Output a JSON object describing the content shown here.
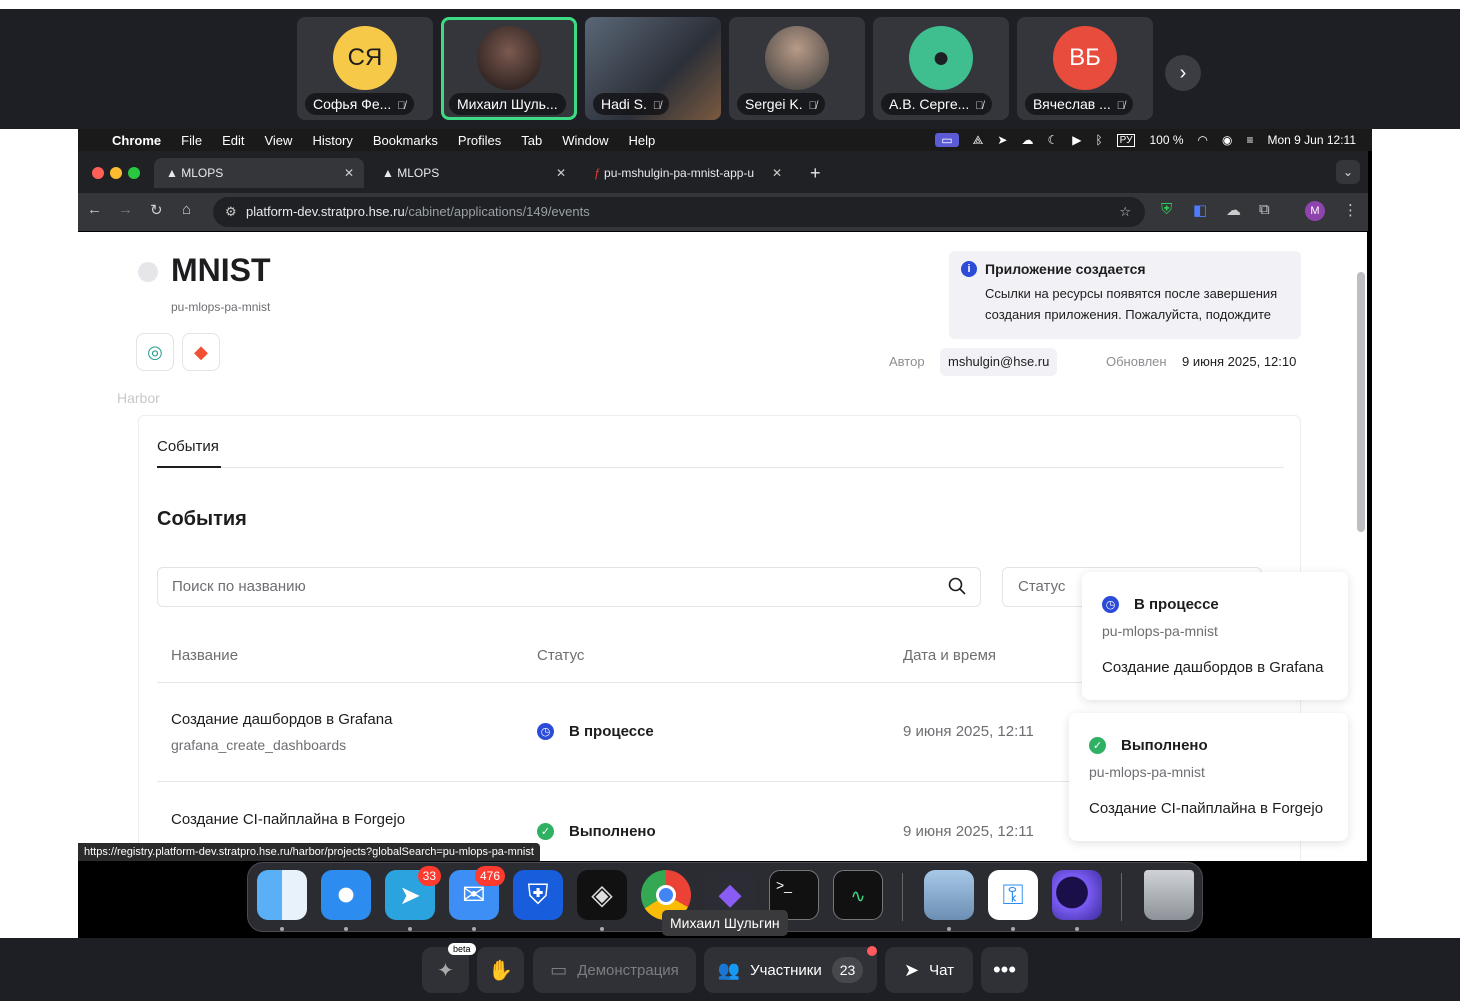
{
  "call": {
    "participants": [
      {
        "initials": "СЯ",
        "name": "Софья Фе...",
        "color": "#f7c948",
        "muted": true,
        "video": false
      },
      {
        "initials": "",
        "name": "Михаил Шуль...",
        "color": "#3a2a2a",
        "muted": false,
        "video": true,
        "active": true
      },
      {
        "initials": "",
        "name": "Hadi S.",
        "color": "#555",
        "muted": true,
        "video": true
      },
      {
        "initials": "",
        "name": "Sergei K.",
        "color": "#555",
        "muted": true,
        "video": true
      },
      {
        "initials": "",
        "name": "А.В. Серге...",
        "color": "#3fbf8f",
        "muted": true,
        "video": false
      },
      {
        "initials": "ВБ",
        "name": "Вячеслав ...",
        "color": "#e74c3c",
        "muted": true,
        "video": false
      }
    ],
    "toolbar": {
      "beta": "beta",
      "demo": "Демонстрация",
      "participants": "Участники",
      "participants_count": "23",
      "chat": "Чат"
    }
  },
  "macos": {
    "menu": [
      "Chrome",
      "File",
      "Edit",
      "View",
      "History",
      "Bookmarks",
      "Profiles",
      "Tab",
      "Window",
      "Help"
    ],
    "keyboard": "РУ",
    "battery": "100 %",
    "clock": "Mon 9 Jun  12:11"
  },
  "browser": {
    "tabs": [
      {
        "title": "MLOPS",
        "active": true
      },
      {
        "title": "MLOPS",
        "active": false
      },
      {
        "title": "pu-mshulgin-pa-mnist-app-u",
        "active": false
      }
    ],
    "url_host": "platform-dev.stratpro.hse.ru",
    "url_path": "/cabinet/applications/149/events",
    "status_url": "https://registry.platform-dev.stratpro.hse.ru/harbor/projects?globalSearch=pu-mlops-pa-mnist"
  },
  "app": {
    "title": "MNIST",
    "subtitle": "pu-mlops-pa-mnist",
    "faded_label": "Harbor",
    "info": {
      "title": "Приложение создается",
      "body_line1": "Ссылки на ресурсы появятся после завершения",
      "body_line2": "создания приложения. Пожалуйста, подождите"
    },
    "author_label": "Автор",
    "author": "mshulgin@hse.ru",
    "updated_label": "Обновлен",
    "updated": "9 июня 2025, 12:10",
    "tab": "События",
    "section_title": "События",
    "search_placeholder": "Поиск по названию",
    "status_placeholder": "Статус",
    "columns": {
      "name": "Название",
      "status": "Статус",
      "date": "Дата и время"
    },
    "rows": [
      {
        "name": "Создание дашбордов в Grafana",
        "code": "grafana_create_dashboards",
        "status": "В процессе",
        "date": "9 июня 2025, 12:11"
      },
      {
        "name": "Создание CI-пайплайна в Forgejo",
        "code": "",
        "status": "Выполнено",
        "date": "9 июня 2025, 12:11"
      }
    ],
    "toasts": [
      {
        "status": "В процессе",
        "app": "pu-mlops-pa-mnist",
        "text": "Создание дашбордов в Grafana"
      },
      {
        "status": "Выполнено",
        "app": "pu-mlops-pa-mnist",
        "text": "Создание CI-пайплайна в Forgejo"
      }
    ]
  },
  "dock": {
    "telegram_badge": "33",
    "mail_badge": "476",
    "hover_label": "Михаил Шульгин"
  },
  "colors": {
    "accent": "#2c4bd8",
    "success": "#2fb163",
    "active_tile": "#3ddc84"
  }
}
